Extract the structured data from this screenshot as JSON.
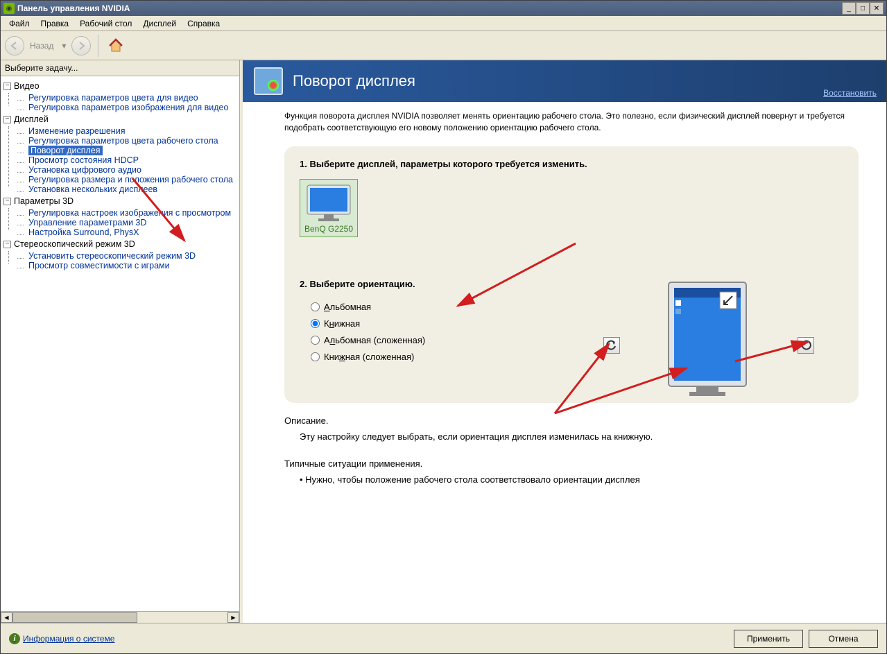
{
  "window": {
    "title": "Панель управления NVIDIA"
  },
  "menu": {
    "file": "Файл",
    "edit": "Правка",
    "desktop": "Рабочий стол",
    "display": "Дисплей",
    "help": "Справка"
  },
  "toolbar": {
    "back": "Назад"
  },
  "sidebar": {
    "header": "Выберите задачу...",
    "cat": {
      "video": "Видео",
      "display": "Дисплей",
      "params3d": "Параметры 3D",
      "stereo": "Стереоскопический режим 3D"
    },
    "items": {
      "video_color": "Регулировка параметров цвета для видео",
      "video_image": "Регулировка параметров изображения для видео",
      "disp_res": "Изменение разрешения",
      "disp_color": "Регулировка параметров цвета рабочего стола",
      "disp_rotate": "Поворот дисплея",
      "disp_hdcp": "Просмотр состояния HDCP",
      "disp_audio": "Установка цифрового аудио",
      "disp_sizepos": "Регулировка размера и положения рабочего стола",
      "disp_multi": "Установка нескольких дисплеев",
      "p3d_imgpreview": "Регулировка настроек изображения с просмотром",
      "p3d_manage": "Управление параметрами 3D",
      "p3d_surround": "Настройка Surround, PhysX",
      "stereo_setup": "Установить стереоскопический режим 3D",
      "stereo_games": "Просмотр совместимости с играми"
    }
  },
  "main": {
    "title": "Поворот дисплея",
    "restore": "Восстановить",
    "intro": "Функция поворота дисплея NVIDIA позволяет менять ориентацию рабочего стола. Это полезно, если физический дисплей повернут и требуется подобрать соответствующую его новому положению ориентацию рабочего стола.",
    "step1": "1. Выберите дисплей, параметры которого требуется изменить.",
    "monitor_name": "BenQ G2250",
    "step2": "2. Выберите ориентацию.",
    "orientations": {
      "landscape": "Альбомная",
      "portrait": "Книжная",
      "landscape_f": "Альбомная (сложенная)",
      "portrait_f": "Книжная (сложенная)"
    },
    "desc_label": "Описание.",
    "desc_text": "Эту настройку следует выбрать, если ориентация дисплея изменилась на книжную.",
    "typical_label": "Типичные ситуации применения.",
    "typical_bullet": "Нужно, чтобы положение рабочего стола соответствовало ориентации дисплея"
  },
  "footer": {
    "sysinfo": "Информация о системе",
    "apply": "Применить",
    "cancel": "Отмена"
  }
}
